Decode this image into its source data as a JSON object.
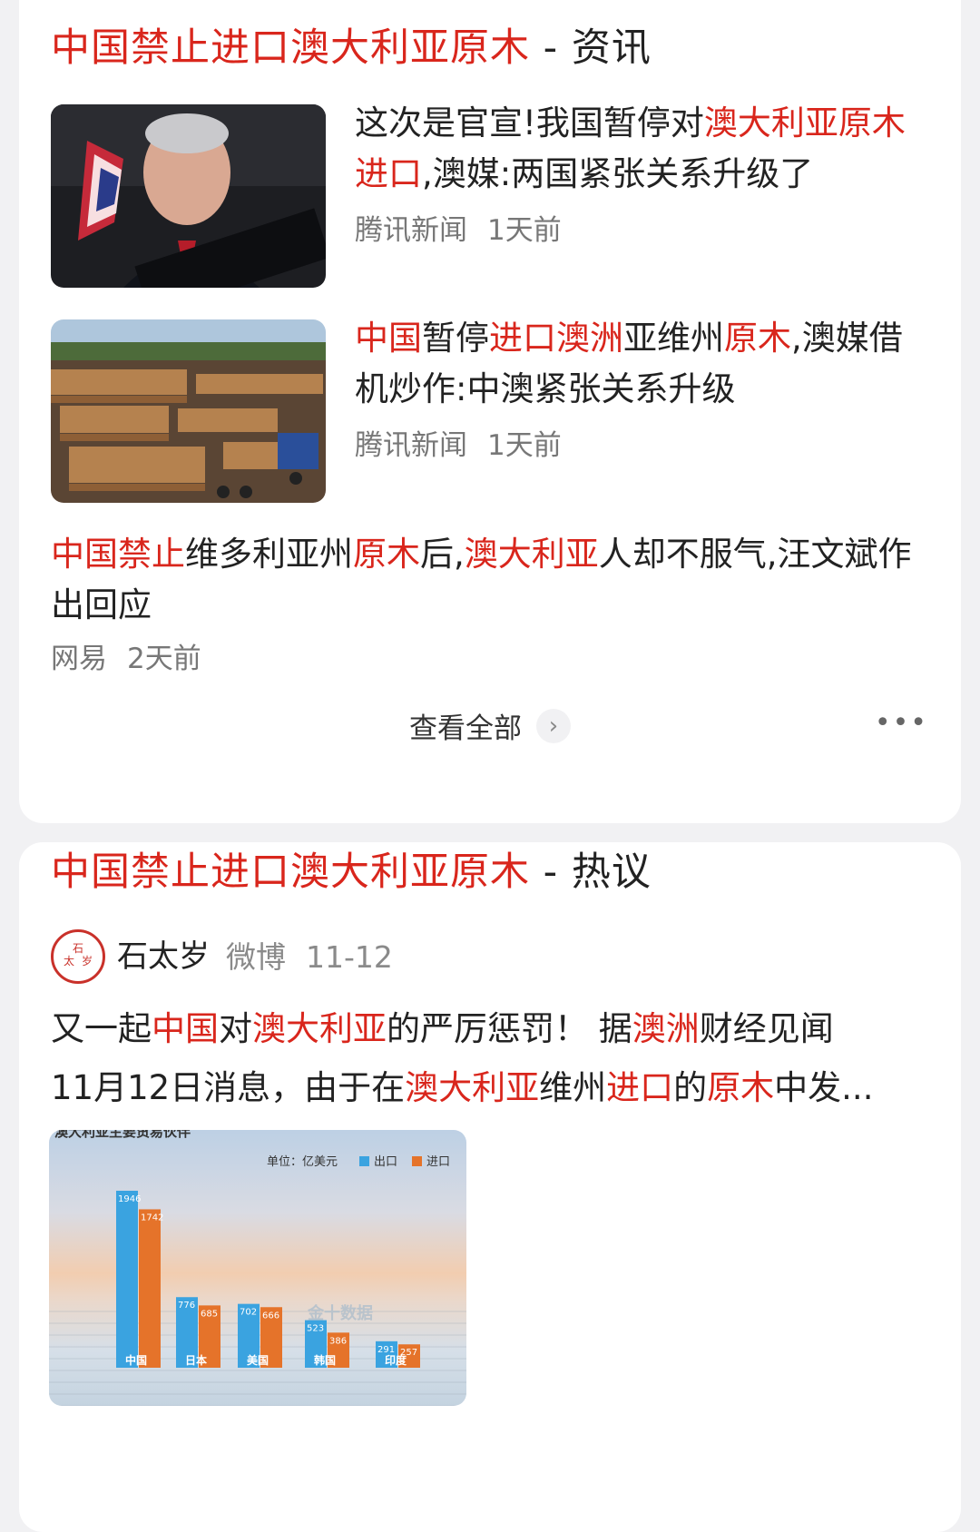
{
  "card1": {
    "title_hl": "中国禁止进口澳大利亚原木",
    "title_rest": " - 资讯",
    "items": [
      {
        "title_parts": [
          "这次是官宣!我国暂停对",
          "澳大利亚原木进口",
          ",澳媒:两国紧张关系升级了"
        ],
        "source": "腾讯新闻",
        "time": "1天前"
      },
      {
        "title_parts": [
          "中国",
          "暂停",
          "进口澳洲",
          "亚维州",
          "原木",
          ",澳媒借机炒作:中澳紧张关系升级"
        ],
        "source": "腾讯新闻",
        "time": "1天前"
      },
      {
        "title_parts": [
          "中国禁止",
          "维多利亚州",
          "原木",
          "后,",
          "澳大利亚",
          "人却不服气,汪文斌作出回应"
        ],
        "source": "网易",
        "time": "2天前"
      }
    ],
    "view_all": "查看全部",
    "more": "•••"
  },
  "card2": {
    "title_hl": "中国禁止进口澳大利亚原木",
    "title_rest": " - 热议",
    "author": "石太岁",
    "platform": "微博",
    "date": "11-12",
    "avatar_text": "石太岁",
    "line1_parts": [
      "又一起",
      "中国",
      "对",
      "澳大利亚",
      "的严厉惩罚！ 据",
      "澳洲",
      "财经见闻"
    ],
    "line2_parts": [
      "11月12日消息，由于在",
      "澳大利亚",
      "维州",
      "进口",
      "的",
      "原木",
      "中发..."
    ]
  },
  "chart_data": {
    "type": "bar",
    "title": "澳大利亚主要贸易伙伴",
    "unit": "单位：亿美元",
    "categories": [
      "中国",
      "日本",
      "美国",
      "韩国",
      "印度"
    ],
    "series": [
      {
        "name": "出口",
        "values": [
          1946,
          776,
          702,
          523,
          291
        ],
        "color": "#3aa3e0"
      },
      {
        "name": "进口",
        "values": [
          1742,
          685,
          666,
          386,
          257
        ],
        "color": "#e5732a"
      }
    ],
    "watermark": "金十数据"
  }
}
